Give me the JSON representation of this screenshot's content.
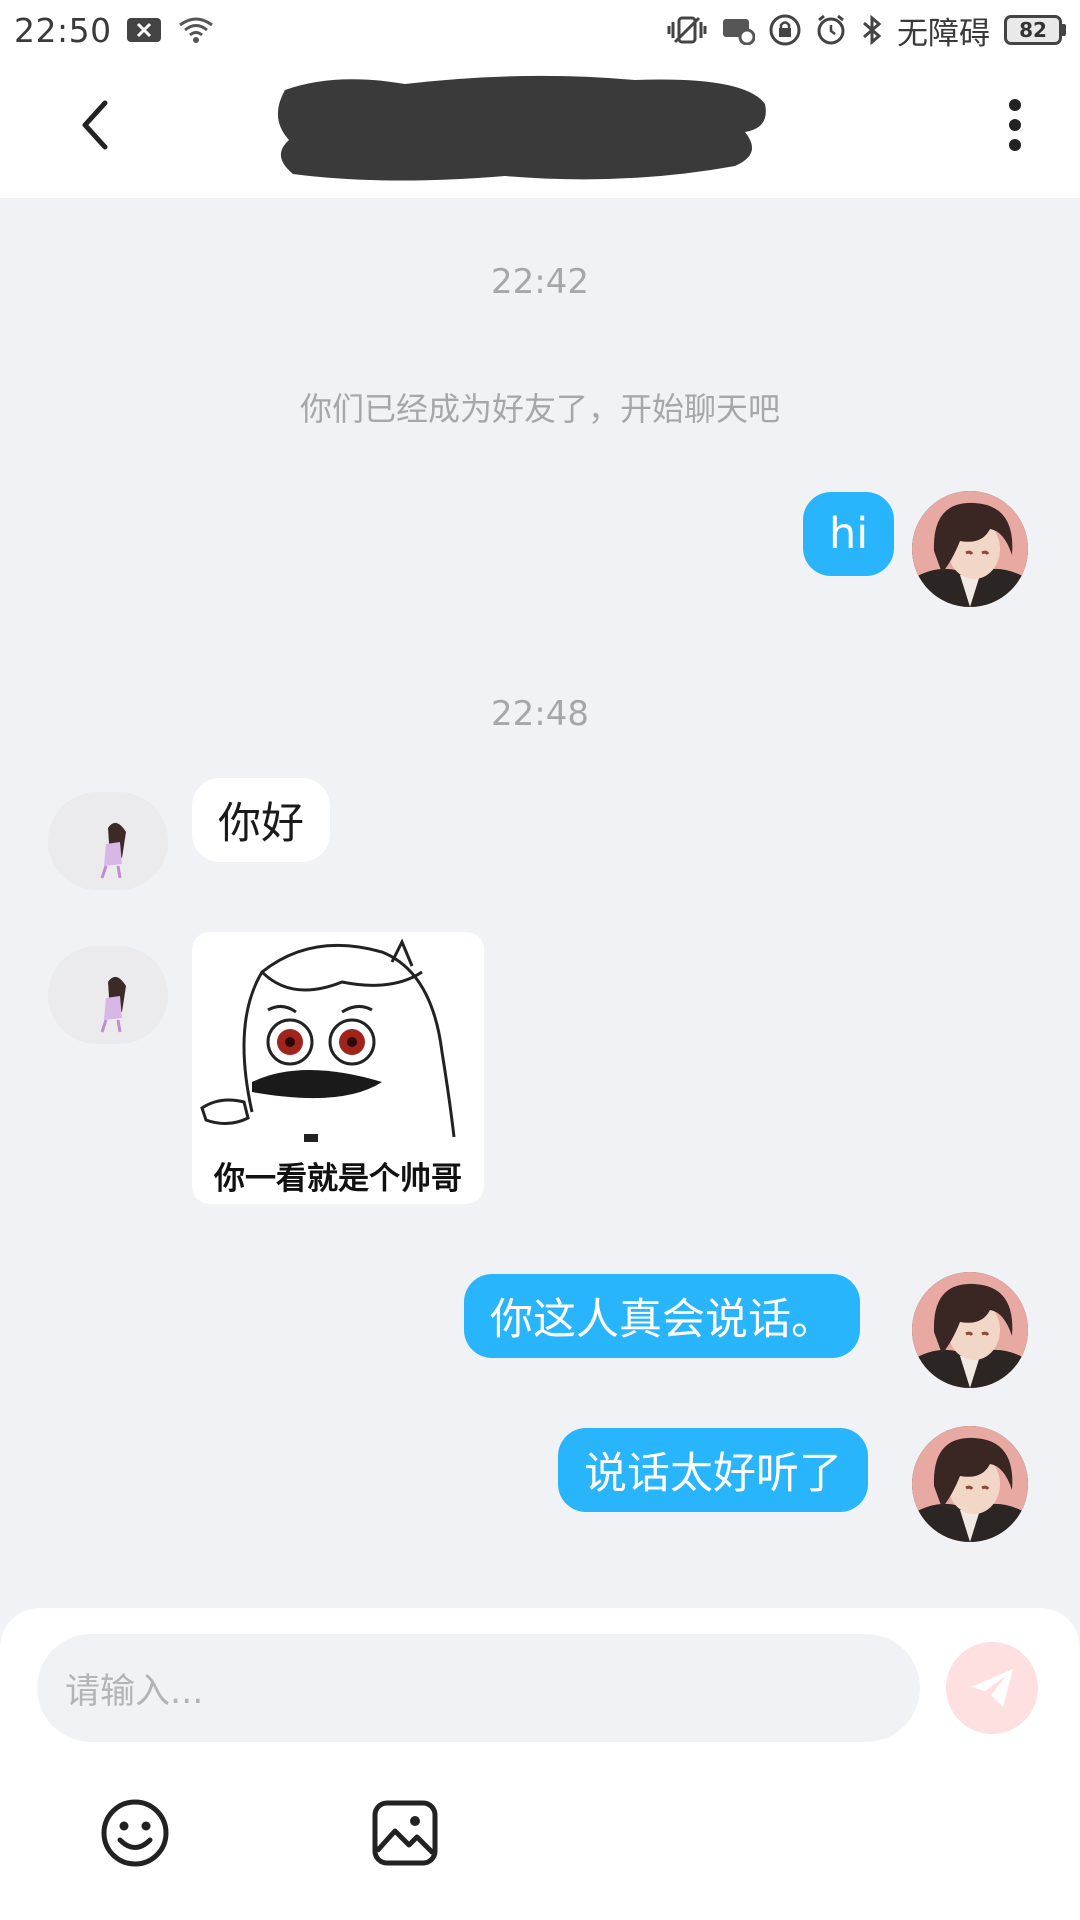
{
  "status_bar": {
    "time": "22:50",
    "accessibility_label": "无障碍",
    "battery_level": "82"
  },
  "header": {
    "back_icon": "chevron-left-icon",
    "more_icon": "more-vertical-icon"
  },
  "chat": {
    "timestamp_1": "22:42",
    "system_message": "你们已经成为好友了，开始聊天吧",
    "msg_hi": "hi",
    "timestamp_2": "22:48",
    "msg_hello": "你好",
    "sticker_caption": "你一看就是个帅哥",
    "msg_reply_1": "你这人真会说话。",
    "msg_reply_2": "说话太好听了"
  },
  "composer": {
    "placeholder": "请输入...",
    "send_icon": "send-icon",
    "emoji_icon": "emoji-icon",
    "image_icon": "image-icon"
  },
  "colors": {
    "my_bubble": "#28b5fb",
    "other_bubble": "#ffffff",
    "chat_background": "#f1f2f5",
    "send_button": "#fde0df"
  }
}
